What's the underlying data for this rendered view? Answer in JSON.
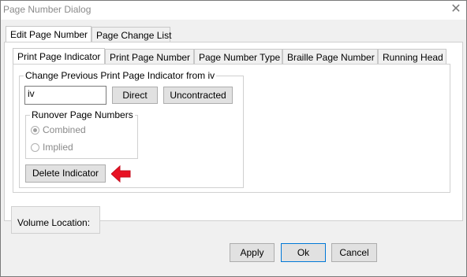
{
  "window": {
    "title": "Page Number Dialog",
    "close_glyph": "✕"
  },
  "main_tabs": [
    {
      "label": "Edit Page Number"
    },
    {
      "label": "Page Change List"
    }
  ],
  "sub_tabs": [
    {
      "label": "Print Page Indicator"
    },
    {
      "label": "Print Page Number"
    },
    {
      "label": "Page Number Type"
    },
    {
      "label": "Braille Page Number"
    },
    {
      "label": "Running Head"
    }
  ],
  "change_group": {
    "legend": "Change Previous Print Page Indicator from iv",
    "input_value": "iv",
    "direct_label": "Direct",
    "uncontracted_label": "Uncontracted"
  },
  "runover_group": {
    "legend": "Runover Page Numbers",
    "options": [
      {
        "label": "Combined"
      },
      {
        "label": "Implied"
      }
    ]
  },
  "delete_indicator_label": "Delete Indicator",
  "volume_location_label": "Volume Location:",
  "footer": {
    "apply_label": "Apply",
    "ok_label": "Ok",
    "cancel_label": "Cancel"
  },
  "colors": {
    "annotation_arrow": "#e81123",
    "focus_border": "#0078d7"
  },
  "icons": {
    "close": "close-icon",
    "annotation": "red-arrow-icon"
  }
}
